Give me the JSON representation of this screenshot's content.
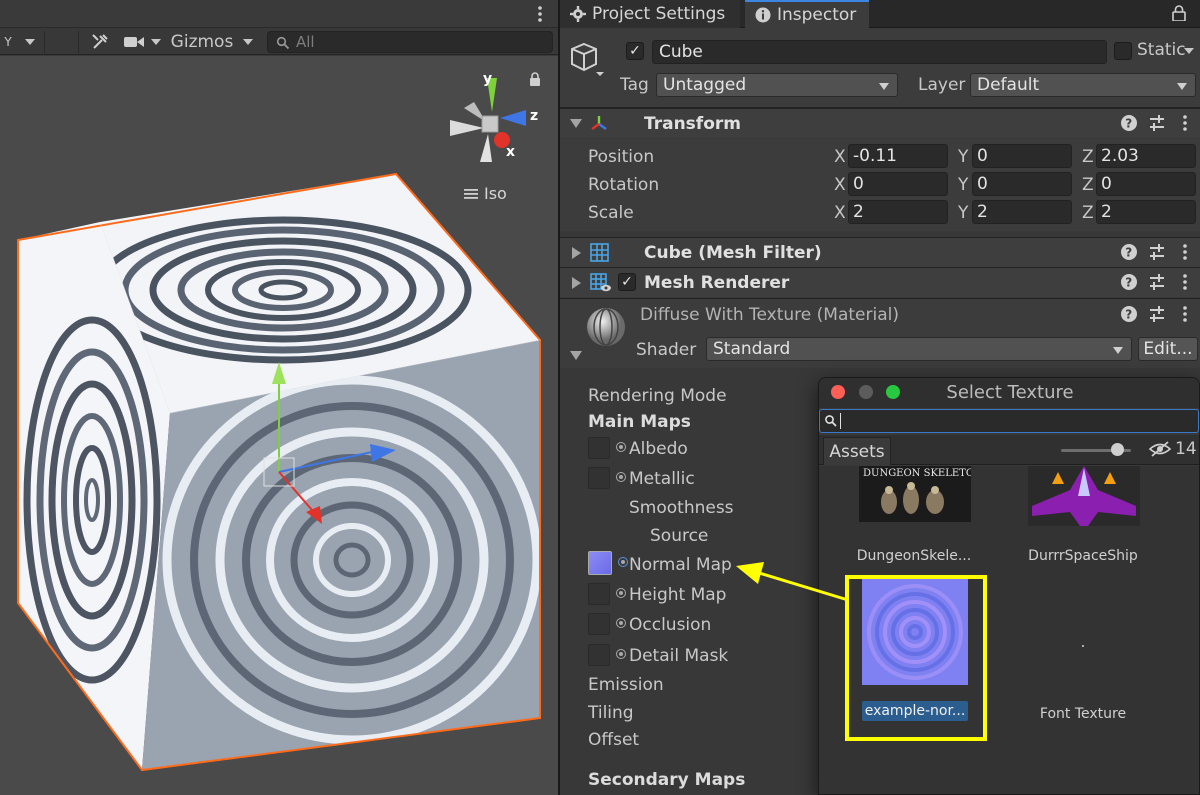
{
  "scene": {
    "toolbar": {
      "gizmos_label": "Gizmos",
      "search_placeholder": "All",
      "partial_label": "Y",
      "tool_icons": [
        "tools-icon",
        "camera-icon"
      ]
    },
    "view_mode": "Iso",
    "gizmo_axes": {
      "x": "x",
      "y": "y",
      "z": "z"
    },
    "selection_outline_color": "#ff6b1a"
  },
  "inspector": {
    "tabs": [
      {
        "label": "Project Settings",
        "icon": "gear-icon"
      },
      {
        "label": "Inspector",
        "icon": "info-icon"
      }
    ],
    "object": {
      "active": true,
      "name": "Cube",
      "static_label": "Static",
      "static": false,
      "tag_label": "Tag",
      "tag_value": "Untagged",
      "layer_label": "Layer",
      "layer_value": "Default"
    },
    "transform": {
      "title": "Transform",
      "rows": [
        {
          "label": "Position",
          "x": "-0.11",
          "y": "0",
          "z": "2.03"
        },
        {
          "label": "Rotation",
          "x": "0",
          "y": "0",
          "z": "0"
        },
        {
          "label": "Scale",
          "x": "2",
          "y": "2",
          "z": "2"
        }
      ]
    },
    "mesh_filter": {
      "title": "Cube (Mesh Filter)"
    },
    "mesh_renderer": {
      "title": "Mesh Renderer",
      "enabled": true
    },
    "material": {
      "title": "Diffuse With Texture (Material)",
      "shader_label": "Shader",
      "shader_value": "Standard",
      "edit_label": "Edit..."
    },
    "properties": {
      "rendering_mode": "Rendering Mode",
      "main_maps": "Main Maps",
      "albedo": "Albedo",
      "metallic": "Metallic",
      "smoothness": "Smoothness",
      "source": "Source",
      "normal_map": "Normal Map",
      "height_map": "Height Map",
      "occlusion": "Occlusion",
      "detail_mask": "Detail Mask",
      "emission": "Emission",
      "tiling": "Tiling",
      "offset": "Offset",
      "secondary_maps": "Secondary Maps"
    }
  },
  "select_texture": {
    "title": "Select Texture",
    "tab": "Assets",
    "hidden_count": "14",
    "assets": [
      {
        "name": "DungeonSkele...",
        "thumb_caption": "DUNGEON SKELETONS"
      },
      {
        "name": "DurrrSpaceShip"
      },
      {
        "name": "example-nor...",
        "selected": true
      },
      {
        "name": "Font Texture"
      }
    ]
  },
  "colors": {
    "accent_blue": "#3b86e0",
    "highlight_yellow": "#ffff00",
    "selection_bg": "#2c5d8f",
    "panel_bg": "#383838"
  }
}
